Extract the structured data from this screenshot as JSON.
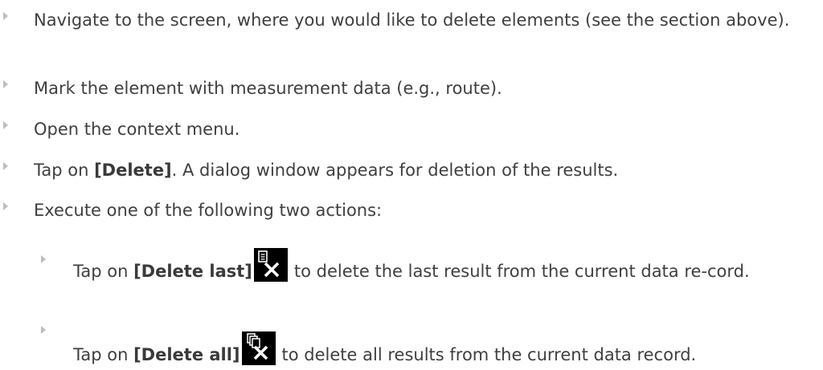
{
  "steps": [
    {
      "text": "Navigate to the screen, where you would like to delete elements (see the section above)."
    },
    {
      "text": "Mark the element with measurement data (e.g., route)."
    },
    {
      "text": "Open the context menu."
    },
    {
      "pre": "Tap on ",
      "bold": "[Delete]",
      "post": ". A dialog window appears for deletion of the results."
    },
    {
      "text": "Execute one of the following two actions:"
    }
  ],
  "substeps": [
    {
      "pre": "Tap on ",
      "bold": "[Delete last]",
      "icon": "delete-last-icon",
      "post": "to delete the last result from the current data re-cord."
    },
    {
      "pre": "Tap on ",
      "bold": "[Delete all]",
      "icon": "delete-all-icon",
      "post": "to delete all results from the current data record."
    }
  ],
  "colors": {
    "text": "#3f3f3f",
    "bullet": "#bdbdbd",
    "icon_bg": "#000000",
    "icon_fg": "#ffffff"
  }
}
